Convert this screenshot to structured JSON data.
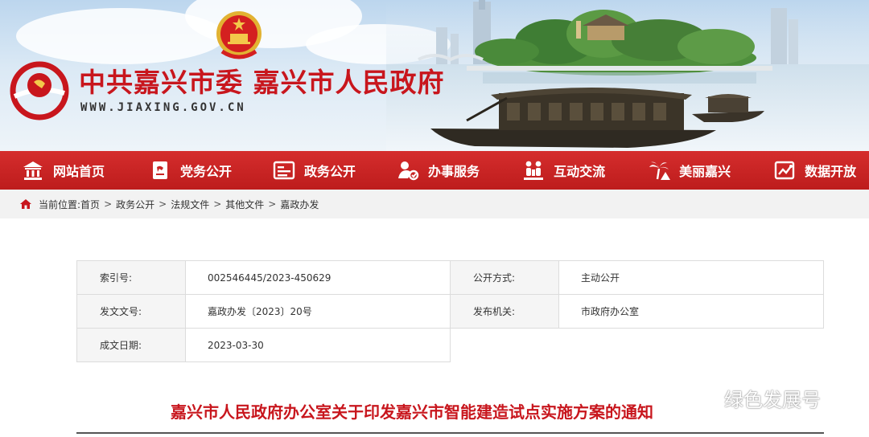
{
  "header": {
    "site_title": "中共嘉兴市委 嘉兴市人民政府",
    "site_url": "WWW.JIAXING.GOV.CN"
  },
  "nav": {
    "items": [
      {
        "label": "网站首页",
        "icon": "museum-icon"
      },
      {
        "label": "党务公开",
        "icon": "party-flag-icon"
      },
      {
        "label": "政务公开",
        "icon": "document-icon"
      },
      {
        "label": "办事服务",
        "icon": "service-icon"
      },
      {
        "label": "互动交流",
        "icon": "people-icon"
      },
      {
        "label": "美丽嘉兴",
        "icon": "palm-tree-icon"
      },
      {
        "label": "数据开放",
        "icon": "data-icon"
      }
    ]
  },
  "breadcrumb": {
    "prefix": "当前位置:",
    "items": [
      "首页",
      "政务公开",
      "法规文件",
      "其他文件",
      "嘉政办发"
    ],
    "separator": ">"
  },
  "info": {
    "index_label": "索引号:",
    "index_value": "002546445/2023-450629",
    "disclosure_label": "公开方式:",
    "disclosure_value": "主动公开",
    "doc_no_label": "发文文号:",
    "doc_no_value": "嘉政办发〔2023〕20号",
    "issuer_label": "发布机关:",
    "issuer_value": "市政府办公室",
    "date_label": "成文日期:",
    "date_value": "2023-03-30"
  },
  "document": {
    "title": "嘉兴市人民政府办公室关于印发嘉兴市智能建造试点实施方案的通知"
  },
  "watermark": {
    "text": "绿色发展号"
  },
  "colors": {
    "brand_red": "#c8161d",
    "nav_red": "#c92424",
    "crumb_bg": "#f2f2f2",
    "table_key_bg": "#f5f5f5"
  }
}
